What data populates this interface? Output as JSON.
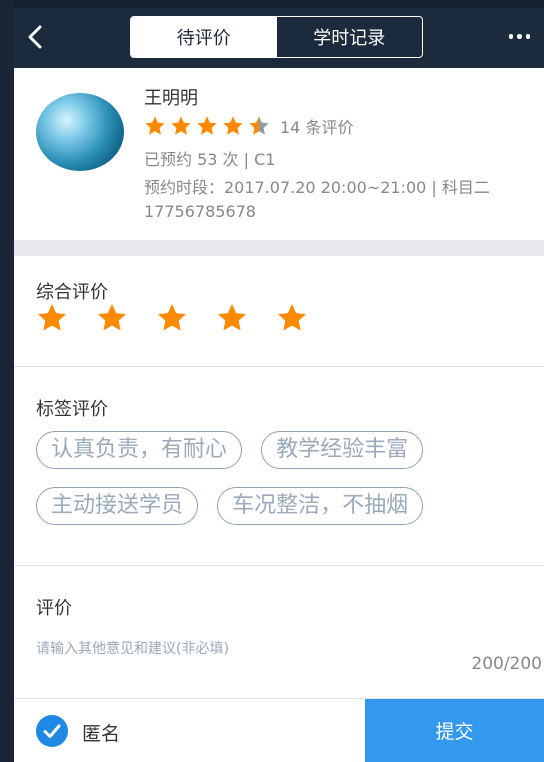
{
  "header": {
    "tabs": [
      {
        "label": "待评价",
        "active": true
      },
      {
        "label": "学时记录",
        "active": false
      }
    ],
    "back_icon": "back-arrow-icon",
    "more_icon": "more-dots-icon"
  },
  "profile": {
    "name": "王明明",
    "rating": 4.5,
    "review_count": "14 条评价",
    "booked": "已预约 53 次 | C1",
    "slot": "预约时段：2017.07.20  20:00~21:00 | 科目二",
    "phone": "17756785678"
  },
  "overall": {
    "title": "综合评价",
    "stars": 5
  },
  "tag_section": {
    "title": "标签评价",
    "tags": [
      "认真负责，有耐心",
      "教学经验丰富",
      "主动接送学员",
      "车况整洁，不抽烟"
    ]
  },
  "comment": {
    "title": "评价",
    "placeholder": "请输入其他意见和建议(非必填)",
    "counter": "200/200"
  },
  "footer": {
    "anonymous_label": "匿名",
    "anonymous_checked": true,
    "submit_label": "提交"
  },
  "colors": {
    "header_bg": "#1b2a3c",
    "star": "#ff8a00",
    "accent": "#3399ee",
    "tag_border": "#8ea3b8"
  }
}
